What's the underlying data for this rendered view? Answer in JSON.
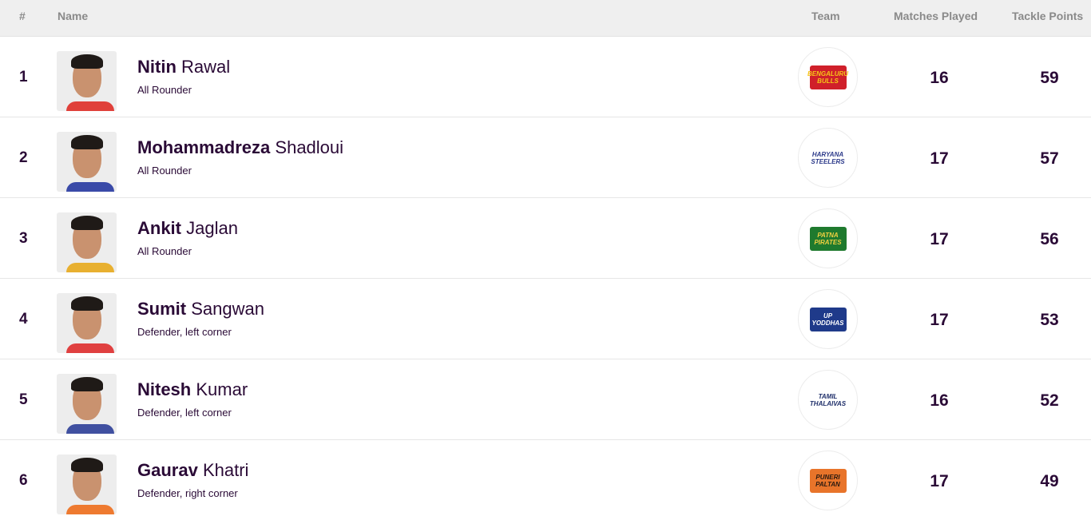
{
  "header": {
    "rank": "#",
    "name": "Name",
    "team": "Team",
    "matches": "Matches Played",
    "tackle": "Tackle Points"
  },
  "rows": [
    {
      "rank": "1",
      "first": "Nitin",
      "last": "Rawal",
      "role": "All Rounder",
      "team": "Bengaluru Bulls",
      "team_short": "BENGALURU BULLS",
      "team_color": "#d0202a",
      "team_text_color": "#f5c518",
      "jersey": "#e0403a",
      "matches": "16",
      "tackle": "59"
    },
    {
      "rank": "2",
      "first": "Mohammadreza",
      "last": "Shadloui",
      "role": "All Rounder",
      "team": "Haryana Steelers",
      "team_short": "HARYANA STEELERS",
      "team_color": "#ffffff",
      "team_text_color": "#2c3a8a",
      "jersey": "#3a4aa8",
      "matches": "17",
      "tackle": "57"
    },
    {
      "rank": "3",
      "first": "Ankit",
      "last": "Jaglan",
      "role": "All Rounder",
      "team": "Patna Pirates",
      "team_short": "PATNA PIRATES",
      "team_color": "#1f7a2e",
      "team_text_color": "#f0d040",
      "jersey": "#e8b030",
      "matches": "17",
      "tackle": "56"
    },
    {
      "rank": "4",
      "first": "Sumit",
      "last": "Sangwan",
      "role": "Defender, left corner",
      "team": "UP Yoddhas",
      "team_short": "UP YODDHAS",
      "team_color": "#1f3a8a",
      "team_text_color": "#ffffff",
      "jersey": "#e04040",
      "matches": "17",
      "tackle": "53"
    },
    {
      "rank": "5",
      "first": "Nitesh",
      "last": "Kumar",
      "role": "Defender, left corner",
      "team": "Tamil Thalaivas",
      "team_short": "TAMIL THALAIVAS",
      "team_color": "#ffffff",
      "team_text_color": "#1f2f6a",
      "jersey": "#4050a0",
      "matches": "16",
      "tackle": "52"
    },
    {
      "rank": "6",
      "first": "Gaurav",
      "last": "Khatri",
      "role": "Defender, right corner",
      "team": "Puneri Paltan",
      "team_short": "PUNERI PALTAN",
      "team_color": "#e8742a",
      "team_text_color": "#2a1a10",
      "jersey": "#ee7a30",
      "matches": "17",
      "tackle": "49"
    }
  ]
}
